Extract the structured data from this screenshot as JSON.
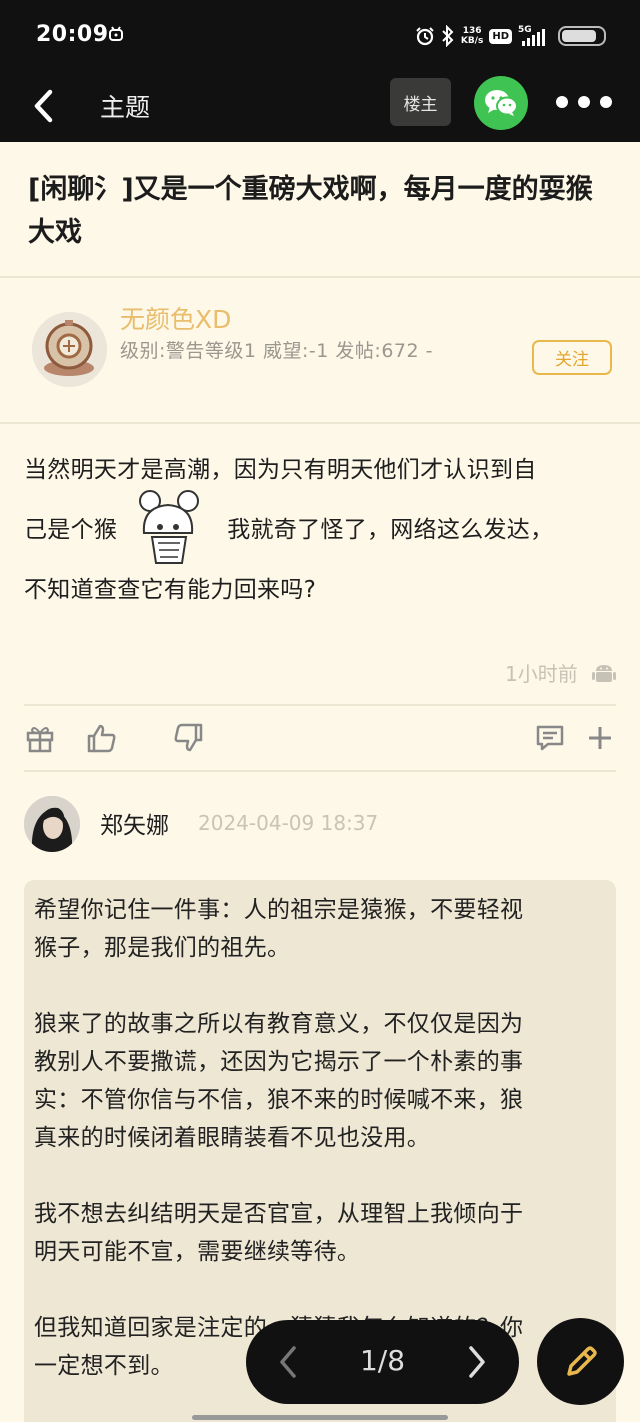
{
  "status_bar": {
    "time": "20:09",
    "net_speed_value": "136",
    "net_speed_unit": "KB/s",
    "hd_label": "HD",
    "network_label": "5G",
    "battery_level": 0.85
  },
  "header": {
    "title": "主题",
    "louzhu_label": "楼主"
  },
  "topic": {
    "title": "[闲聊氵]又是一个重磅大戏啊，每月一度的耍猴大戏"
  },
  "author": {
    "name": "无颜色XD",
    "meta": "级别:警告等级1 威望:-1 发帖:672 -",
    "follow_label": "关注"
  },
  "post": {
    "line1": "当然明天才是高潮，因为只有明天他们才认识到自",
    "line2a": "己是个猴",
    "line2b": "我就奇了怪了，网络这么发达，",
    "line3": "不知道查查它有能力回来吗?",
    "time": "1小时前"
  },
  "comment": {
    "name": "郑矢娜",
    "time": "2024-04-09 18:37",
    "text": "希望你记住一件事：人的祖宗是猿猴，不要轻视\n猴子，那是我们的祖先。\n\n狼来了的故事之所以有教育意义，不仅仅是因为\n教别人不要撒谎，还因为它揭示了一个朴素的事\n实：不管你信与不信，狼不来的时候喊不来，狼\n真来的时候闭着眼睛装看不见也没用。\n\n我不想去纠结明天是否官宣，从理智上我倾向于\n明天可能不宣，需要继续等待。\n\n但我知道回家是注定的，猜猜我怎么知道的？你\n一定想不到。"
  },
  "pager": {
    "label": "1/8"
  },
  "colors": {
    "accent": "#e9b84d",
    "background": "#fdf8e8",
    "header_bg": "#111111",
    "wechat_green": "#3fc352"
  }
}
